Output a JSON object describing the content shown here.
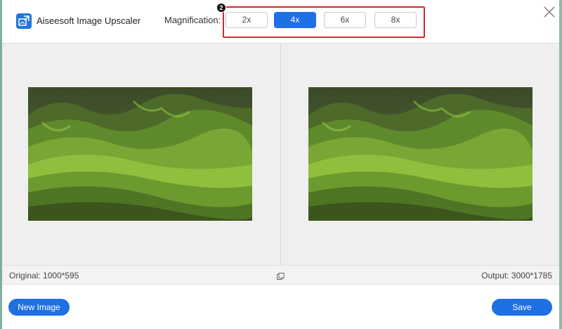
{
  "header": {
    "app_title": "Aiseesoft Image Upscaler",
    "app_icon": "image-upscale-icon",
    "magnification_label": "Magnification:",
    "options": [
      {
        "label": "2x",
        "selected": false
      },
      {
        "label": "4x",
        "selected": true
      },
      {
        "label": "6x",
        "selected": false
      },
      {
        "label": "8x",
        "selected": false
      }
    ],
    "step_badge": "2",
    "close_icon": "close-icon"
  },
  "preview": {
    "original_image": "landscape-green-hills",
    "output_image": "landscape-green-hills"
  },
  "info": {
    "original": "Original: 1000*595",
    "output": "Output: 3000*1785",
    "compare_icon": "compare-icon"
  },
  "footer": {
    "new_image_label": "New Image",
    "save_label": "Save"
  },
  "colors": {
    "accent": "#1f6fe5",
    "highlight": "#d6262f",
    "preview_bg": "#efefef"
  }
}
